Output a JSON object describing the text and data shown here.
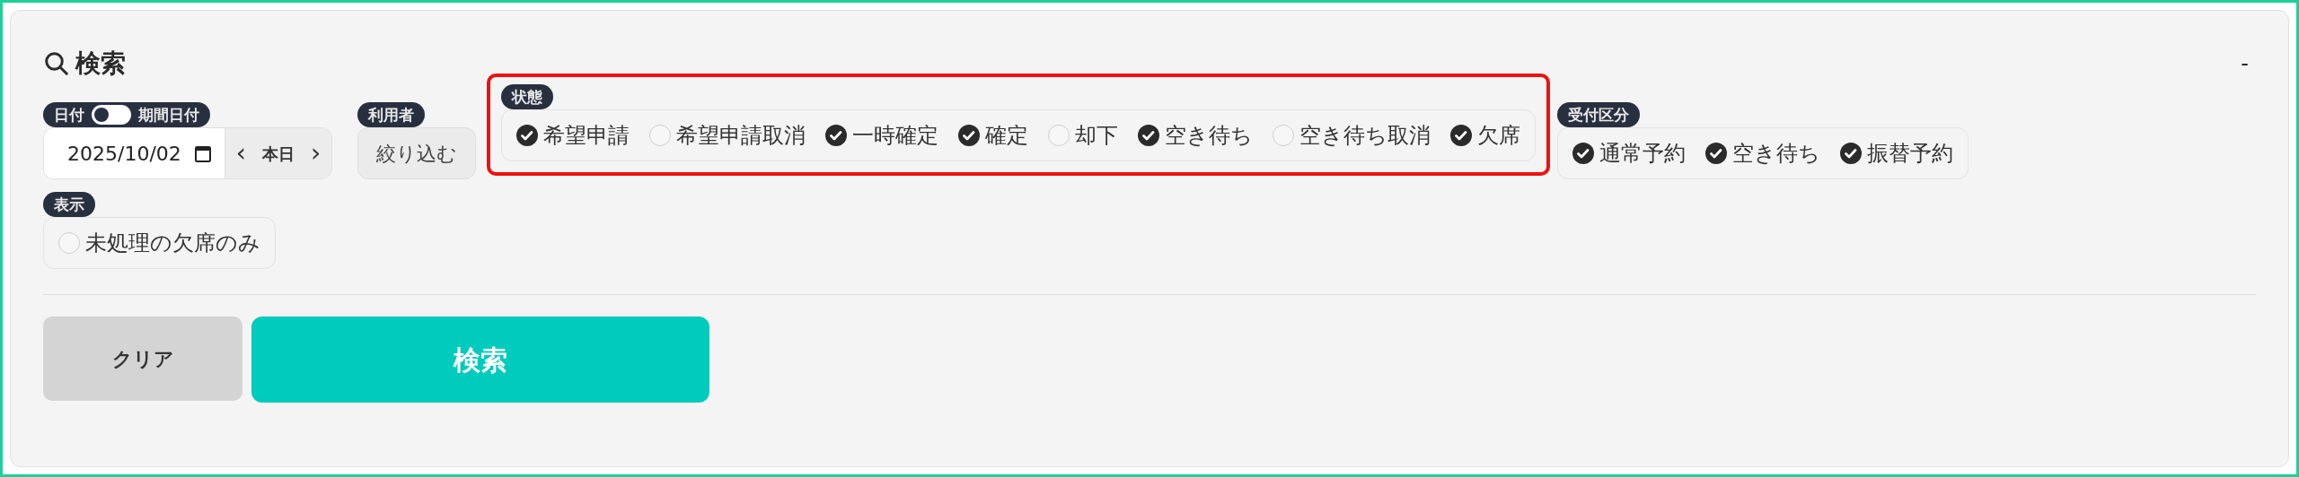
{
  "panel": {
    "title": "検索",
    "collapse": "-"
  },
  "date": {
    "label": "日付",
    "toggle_on": false,
    "toggle_label": "期間日付",
    "value": "2025/10/02",
    "today": "本日",
    "prev": "‹",
    "next": "›"
  },
  "user": {
    "label": "利用者",
    "button": "絞り込む"
  },
  "status": {
    "label": "状態",
    "highlighted": true,
    "options": [
      {
        "label": "希望申請",
        "checked": true
      },
      {
        "label": "希望申請取消",
        "checked": false
      },
      {
        "label": "一時確定",
        "checked": true
      },
      {
        "label": "確定",
        "checked": true
      },
      {
        "label": "却下",
        "checked": false
      },
      {
        "label": "空き待ち",
        "checked": true
      },
      {
        "label": "空き待ち取消",
        "checked": false
      },
      {
        "label": "欠席",
        "checked": true
      }
    ]
  },
  "reception": {
    "label": "受付区分",
    "options": [
      {
        "label": "通常予約",
        "checked": true
      },
      {
        "label": "空き待ち",
        "checked": true
      },
      {
        "label": "振替予約",
        "checked": true
      }
    ]
  },
  "display": {
    "label": "表示",
    "options": [
      {
        "label": "未処理の欠席のみ",
        "checked": false
      }
    ]
  },
  "buttons": {
    "clear": "クリア",
    "search": "検索"
  }
}
